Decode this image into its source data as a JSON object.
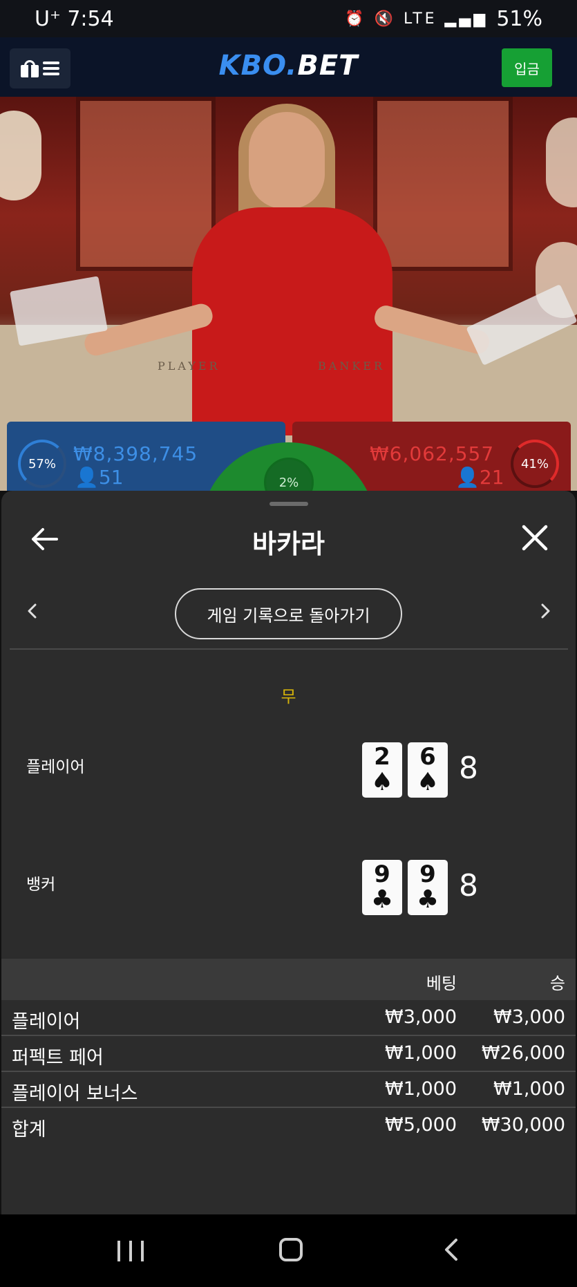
{
  "status_bar": {
    "carrier": "U⁺",
    "time": "7:54",
    "icons": "⏰ 🔇 LTE ▂▄▆",
    "battery": "51%"
  },
  "header": {
    "logo_kbo": "KBO",
    "logo_dot": ".",
    "logo_bet": "BET",
    "deposit_label": "입금"
  },
  "video": {
    "label_player": "PLAYER",
    "label_banker": "BANKER"
  },
  "bets": {
    "player_percent": "57%",
    "player_amount": "₩8,398,745",
    "player_count": "51",
    "banker_percent": "41%",
    "banker_amount": "₩6,062,557",
    "banker_count": "21",
    "tie_percent": "2%"
  },
  "sheet": {
    "title": "바카라",
    "history_button": "게임 기록으로 돌아가기",
    "result": "무",
    "player": {
      "label": "플레이어",
      "cards": [
        {
          "rank": "2",
          "suit": "♠"
        },
        {
          "rank": "6",
          "suit": "♠"
        }
      ],
      "score": "8"
    },
    "banker": {
      "label": "뱅커",
      "cards": [
        {
          "rank": "9",
          "suit": "♣"
        },
        {
          "rank": "9",
          "suit": "♣"
        }
      ],
      "score": "8"
    },
    "table": {
      "headers": {
        "bet": "베팅",
        "win": "승"
      },
      "rows": [
        {
          "label": "플레이어",
          "bet": "₩3,000",
          "win": "₩3,000"
        },
        {
          "label": "퍼펙트 페어",
          "bet": "₩1,000",
          "win": "₩26,000"
        },
        {
          "label": "플레이어 보너스",
          "bet": "₩1,000",
          "win": "₩1,000"
        }
      ],
      "total": {
        "label": "합계",
        "bet": "₩5,000",
        "win": "₩30,000"
      }
    }
  },
  "colors": {
    "player_blue": "#1f4d86",
    "banker_red": "#8a1a1a",
    "tie_green": "#1d8a2e",
    "deposit_green": "#16a034",
    "result_yellow": "#d4b20a"
  }
}
